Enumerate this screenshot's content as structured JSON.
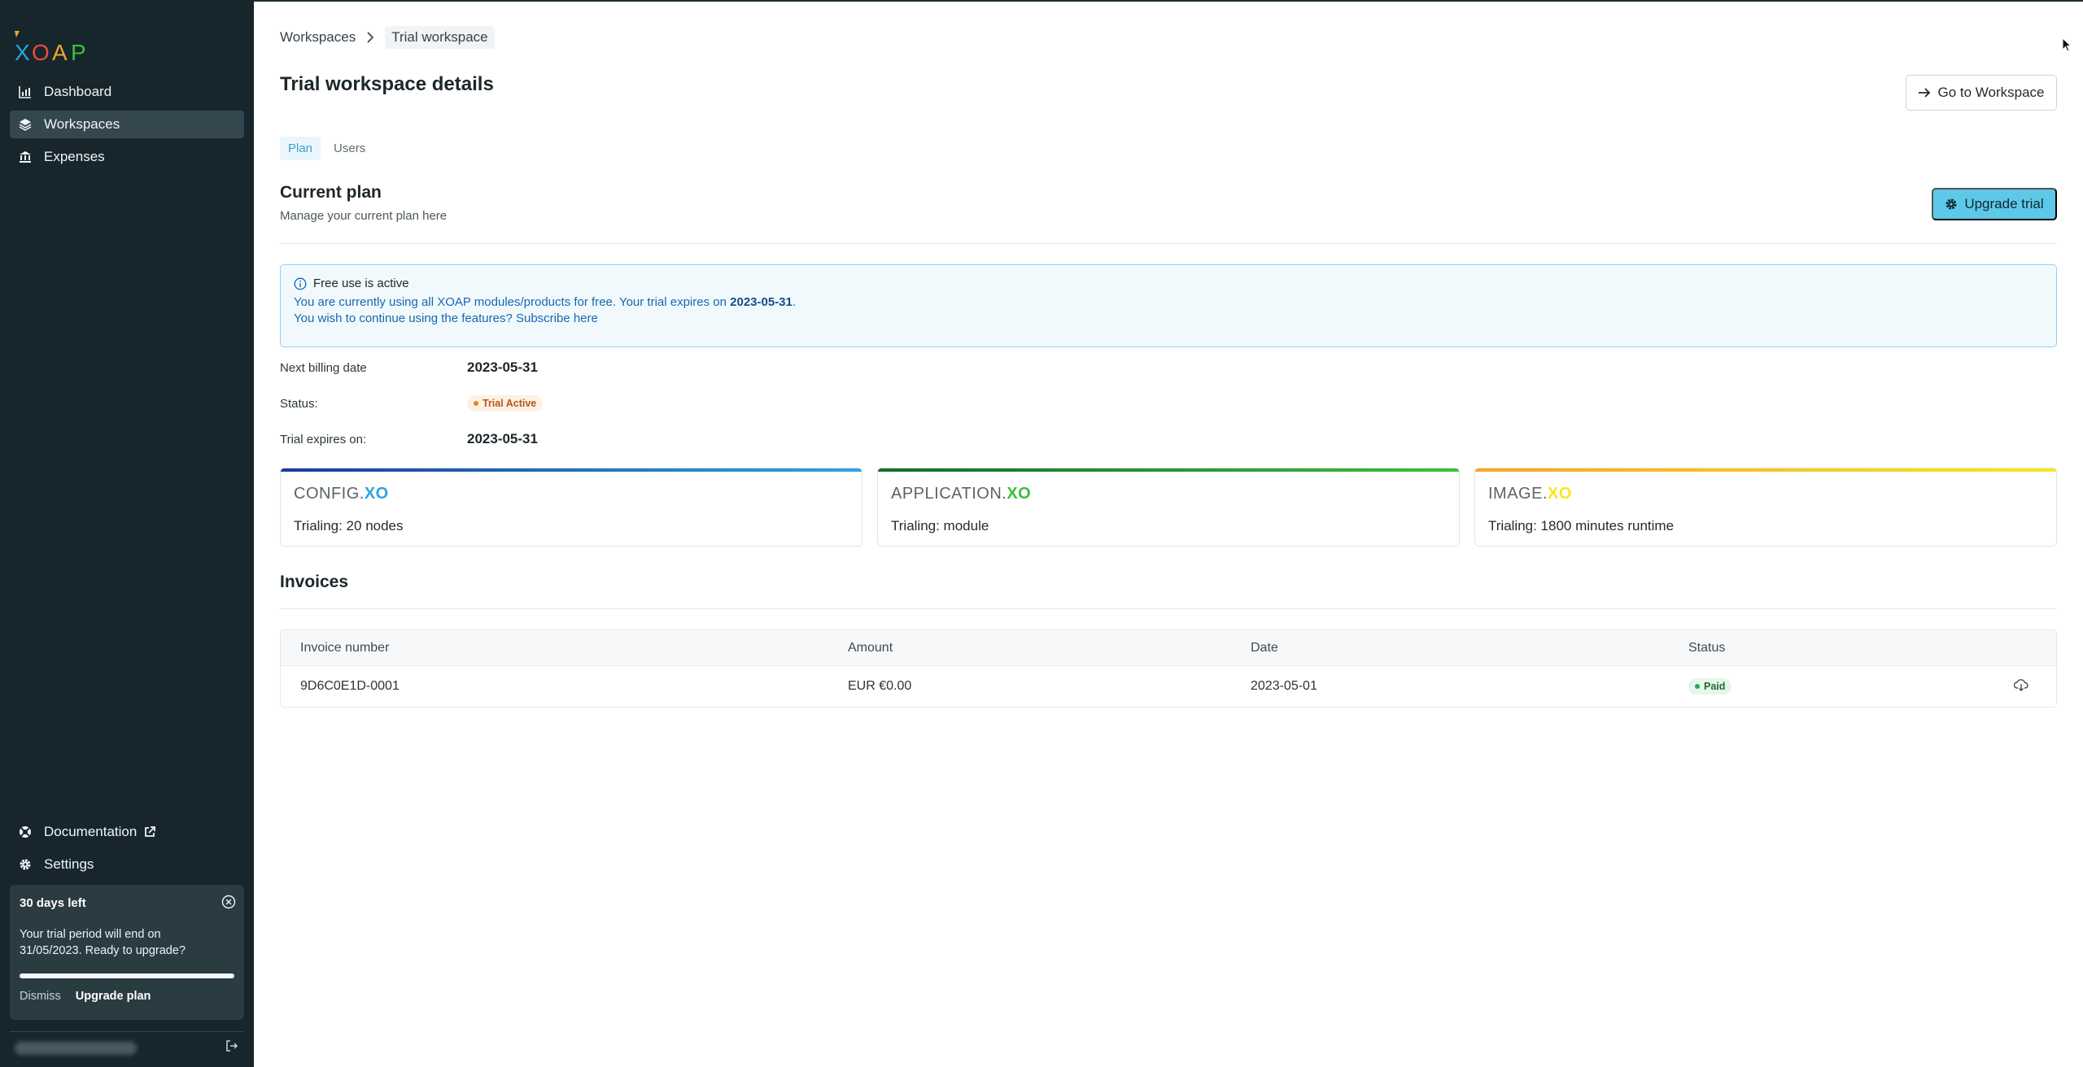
{
  "sidebar": {
    "logo_text": "XOAP",
    "nav": [
      {
        "label": "Dashboard",
        "icon": "chart-bar-icon"
      },
      {
        "label": "Workspaces",
        "icon": "layers-icon",
        "active": true
      },
      {
        "label": "Expenses",
        "icon": "bank-icon"
      }
    ],
    "bottom_nav": [
      {
        "label": "Documentation",
        "icon": "lifebuoy-icon",
        "external": true
      },
      {
        "label": "Settings",
        "icon": "gear-icon"
      }
    ],
    "trial_card": {
      "title": "30 days left",
      "body": "Your trial period will end on 31/05/2023. Ready to upgrade?",
      "progress": 1.0,
      "dismiss_label": "Dismiss",
      "upgrade_label": "Upgrade plan"
    }
  },
  "breadcrumb": {
    "root": "Workspaces",
    "current": "Trial workspace"
  },
  "page": {
    "title": "Trial workspace details",
    "goto_label": "Go to Workspace",
    "tabs": [
      {
        "label": "Plan",
        "active": true
      },
      {
        "label": "Users"
      }
    ]
  },
  "current_plan": {
    "title": "Current plan",
    "subtitle": "Manage your current plan here",
    "upgrade_label": "Upgrade trial",
    "alert": {
      "title": "Free use is active",
      "line1_prefix": "You are currently using all XOAP modules/products for free. Your trial expires on ",
      "line1_date": "2023-05-31",
      "line1_suffix": ".",
      "line2_prefix": "You wish to continue using the features? ",
      "line2_link": "Subscribe here"
    },
    "next_billing_label": "Next billing date",
    "next_billing_value": "2023-05-31",
    "status_label": "Status:",
    "status_value": "Trial Active",
    "expires_label": "Trial expires on:",
    "expires_value": "2023-05-31"
  },
  "products": [
    {
      "brand_prefix": "CONFIG.",
      "brand_suffix": "XO",
      "detail": "Trialing: 20 nodes",
      "color": "#1b3a9a",
      "color2": "#2aa6e0"
    },
    {
      "brand_prefix": "APPLICATION.",
      "brand_suffix": "XO",
      "detail": "Trialing: module",
      "color": "#146b2a",
      "color2": "#3cbf3c"
    },
    {
      "brand_prefix": "IMAGE.",
      "brand_suffix": "XO",
      "detail": "Trialing: 1800 minutes runtime",
      "color": "#f5a623",
      "color2": "#f8e71c"
    }
  ],
  "invoices": {
    "title": "Invoices",
    "columns": [
      "Invoice number",
      "Amount",
      "Date",
      "Status"
    ],
    "rows": [
      {
        "number": "9D6C0E1D-0001",
        "amount": "EUR €0.00",
        "date": "2023-05-01",
        "status": "Paid"
      }
    ]
  },
  "colors": {
    "sidebar_bg": "#16262c",
    "accent": "#5ec8e8"
  }
}
